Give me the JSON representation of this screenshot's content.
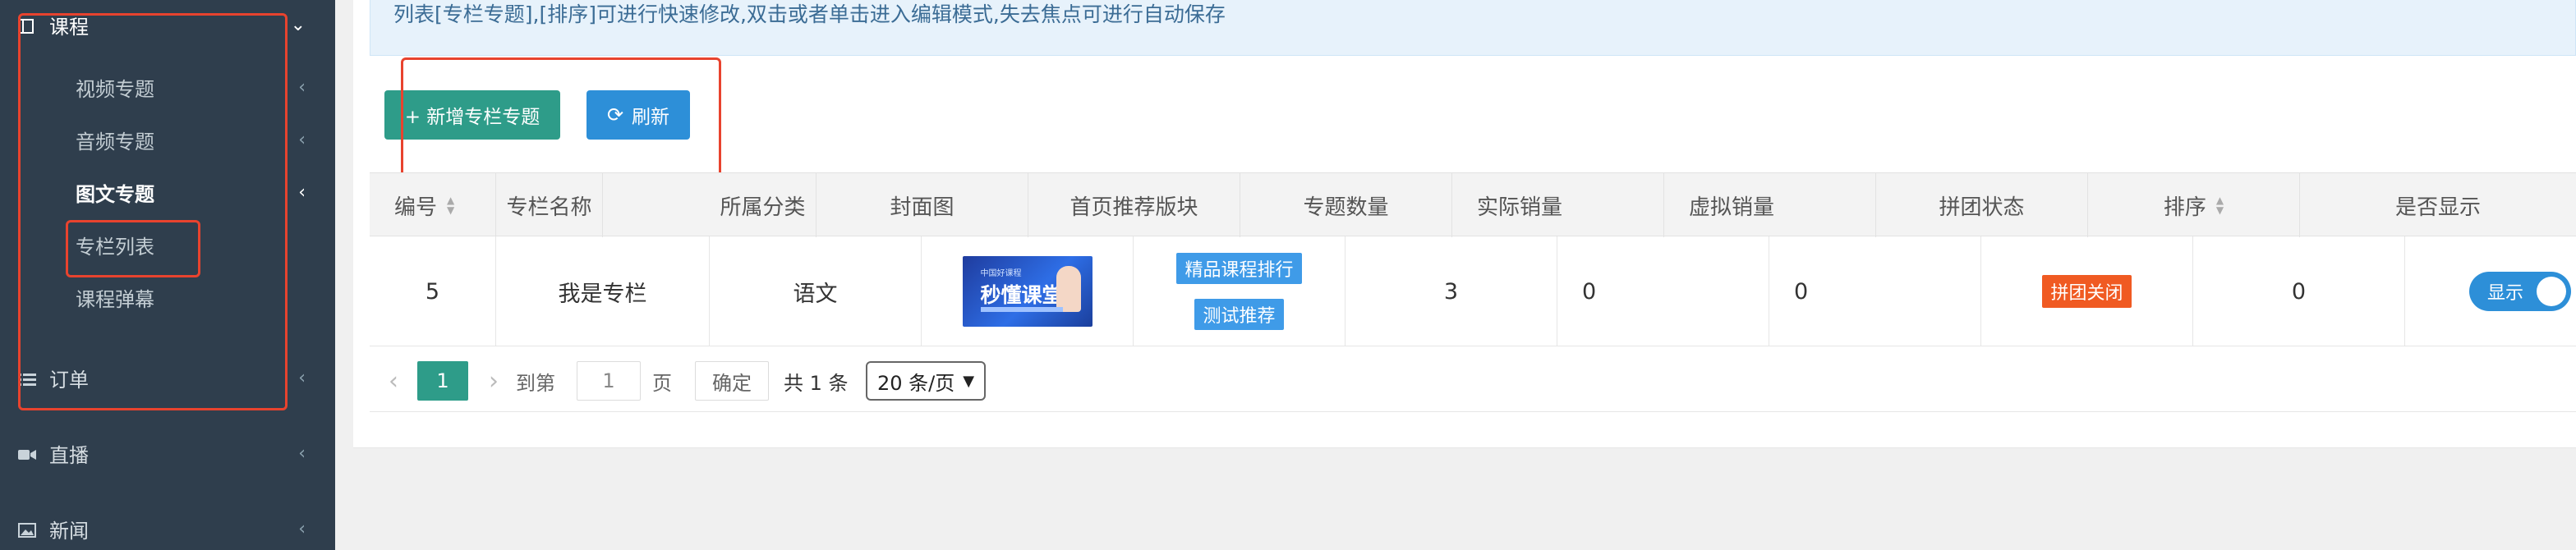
{
  "sidebar": {
    "items": [
      {
        "label": "课程",
        "icon": "book-icon"
      },
      {
        "label": "视频专题"
      },
      {
        "label": "音频专题"
      },
      {
        "label": "图文专题"
      },
      {
        "label": "专栏列表"
      },
      {
        "label": "课程弹幕"
      },
      {
        "label": "订单",
        "icon": "list-icon"
      },
      {
        "label": "直播",
        "icon": "video-camera-icon"
      },
      {
        "label": "新闻",
        "icon": "image-icon"
      }
    ],
    "chevron_left": "‹",
    "chevron_down": "⌄"
  },
  "tip": {
    "text": "列表[专栏专题],[排序]可进行快速修改,双击或者单击进入编辑模式,失去焦点可进行自动保存"
  },
  "toolbar": {
    "add_label": "+ 新增专栏专题",
    "refresh_icon": "⟳",
    "refresh_label": "刷新"
  },
  "table": {
    "headers": [
      "编号",
      "专栏名称",
      "所属分类",
      "封面图",
      "首页推荐版块",
      "专题数量",
      "实际销量",
      "虚拟销量",
      "拼团状态",
      "排序",
      "是否显示"
    ],
    "row": {
      "id": "5",
      "name": "我是专栏",
      "category": "语文",
      "cover_title": "秒懂课堂",
      "cover_sub": "中国好课程",
      "recommend": [
        "精品课程排行",
        "测试推荐"
      ],
      "count": "3",
      "actual_sales": "0",
      "virtual_sales": "0",
      "group_status": "拼团关闭",
      "sort": "0",
      "show_label": "显示"
    }
  },
  "pager": {
    "prev": "‹",
    "current": "1",
    "next": "›",
    "goto_label": "到第",
    "goto_value": "1",
    "page_unit": "页",
    "confirm": "确定",
    "total": "共 1 条",
    "page_size": "20 条/页"
  },
  "colors": {
    "sidebar_bg": "#2f3e4d",
    "primary_green": "#2e9c89",
    "primary_blue": "#2d8fd8",
    "highlight_red": "#e8432e",
    "tag_red": "#f05a22"
  }
}
